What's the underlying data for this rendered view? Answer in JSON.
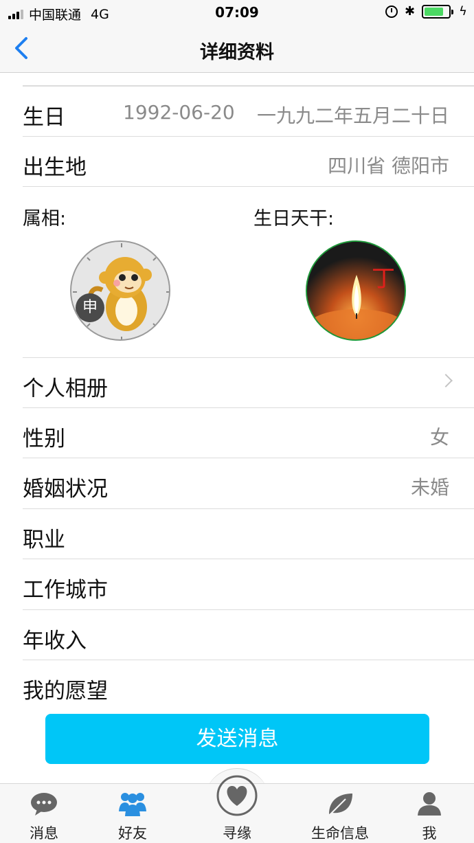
{
  "status": {
    "carrier": "中国联通",
    "network": "4G",
    "time": "07:09",
    "bluetooth": "✱",
    "bolt": "ϟ",
    "battery_fraction": 0.8
  },
  "nav": {
    "title": "详细资料"
  },
  "rows": {
    "birthday": {
      "label": "生日",
      "solar": "1992-06-20",
      "lunar": "一九九二年五月二十日"
    },
    "birthplace": {
      "label": "出生地",
      "value": "四川省 德阳市"
    },
    "album": {
      "label": "个人相册"
    },
    "gender": {
      "label": "性别",
      "value": "女"
    },
    "marital": {
      "label": "婚姻状况",
      "value": "未婚"
    },
    "job": {
      "label": "职业",
      "value": ""
    },
    "work_city": {
      "label": "工作城市",
      "value": ""
    },
    "income": {
      "label": "年收入",
      "value": ""
    },
    "wish": {
      "label": "我的愿望",
      "value": ""
    }
  },
  "zodiac": {
    "label": "属相:",
    "badge": "申"
  },
  "stem": {
    "label": "生日天干:",
    "char": "丁"
  },
  "send_button": "发送消息",
  "tabs": [
    {
      "label": "消息",
      "icon": "chat-icon"
    },
    {
      "label": "好友",
      "icon": "friends-icon"
    },
    {
      "label": "寻缘",
      "icon": "heart-icon"
    },
    {
      "label": "生命信息",
      "icon": "leaf-icon"
    },
    {
      "label": "我",
      "icon": "person-icon"
    }
  ],
  "colors": {
    "accent": "#1e7ff0",
    "send_button": "#00c6f7",
    "active_tab": "#2a8fe0"
  }
}
